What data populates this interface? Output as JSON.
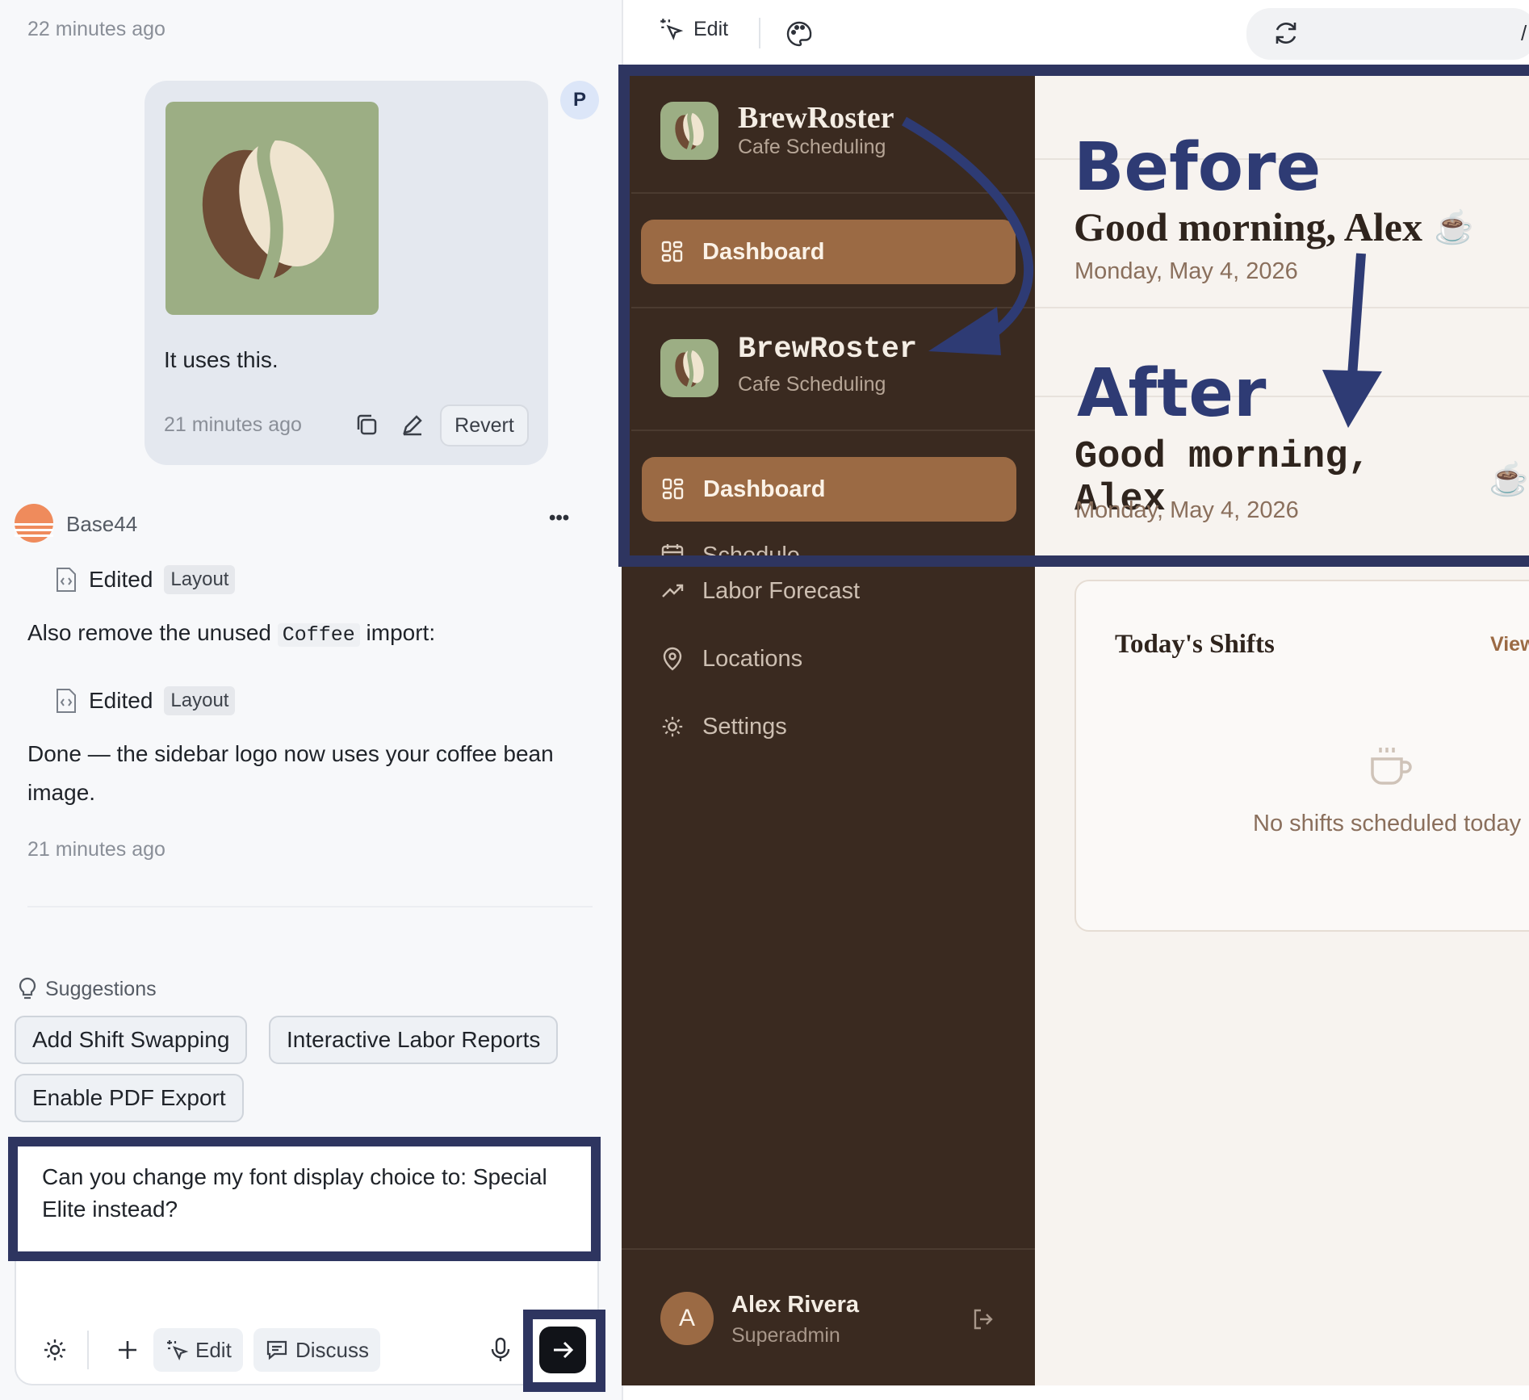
{
  "chat": {
    "top_timestamp": "22 minutes ago",
    "user_avatar": "P",
    "user_message": {
      "text": "It uses this.",
      "timestamp": "21 minutes ago",
      "revert_label": "Revert",
      "image_icon": "coffee-bean-logo"
    },
    "assistant": {
      "name": "Base44",
      "menu_label": "•••",
      "edit1": {
        "label": "Edited",
        "tag": "Layout"
      },
      "message_before_code": "Also remove the unused",
      "code": "Coffee",
      "message_after_code": "import:",
      "edit2": {
        "label": "Edited",
        "tag": "Layout"
      },
      "done_text_line1": "Done — the sidebar logo now uses your coffee bean",
      "done_text_line2": "image.",
      "timestamp": "21 minutes ago"
    },
    "suggestions": {
      "title": "Suggestions",
      "items": [
        "Add Shift Swapping",
        "Interactive Labor Reports",
        "Enable PDF Export"
      ]
    },
    "composer": {
      "text_line1": "Can you change my font display choice to: Special",
      "text_line2": "Elite instead?",
      "edit_label": "Edit",
      "discuss_label": "Discuss"
    }
  },
  "preview": {
    "toolbar": {
      "edit_label": "Edit",
      "url_partial": "/"
    },
    "app": {
      "brand": "BrewRoster",
      "brand_sub": "Cafe Scheduling",
      "nav": {
        "dashboard": "Dashboard",
        "schedule_partial": "Schedule",
        "labor_forecast": "Labor Forecast",
        "locations": "Locations",
        "settings": "Settings"
      },
      "greeting": "Good morning, Alex",
      "greeting_emoji": "☕",
      "date": "Monday, May 4, 2026",
      "card": {
        "title": "Today's Shifts",
        "link": "View",
        "empty_text": "No shifts scheduled today"
      },
      "user": {
        "initial": "A",
        "name": "Alex Rivera",
        "role": "Superadmin"
      }
    },
    "annotation": {
      "before": "Before",
      "after": "After",
      "highlight_color": "#2e3560"
    }
  }
}
